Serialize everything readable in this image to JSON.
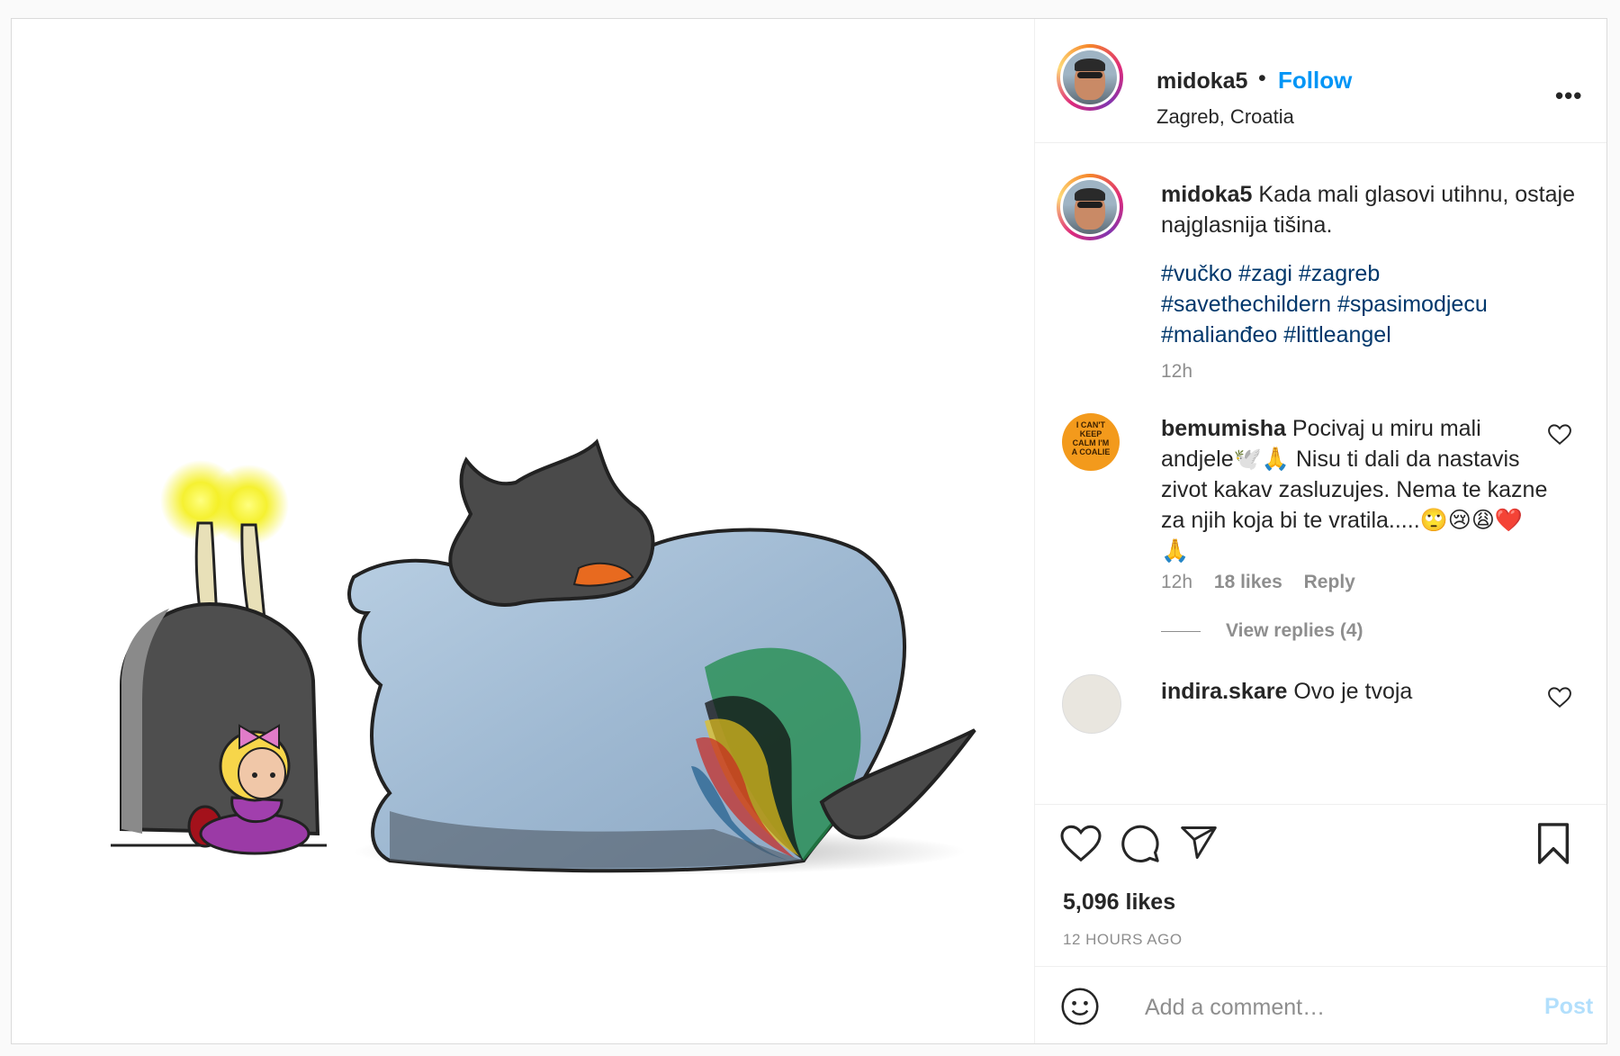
{
  "post": {
    "author": "midoka5",
    "separator": "•",
    "follow_label": "Follow",
    "location": "Zagreb, Croatia",
    "more_label": "•••",
    "caption": {
      "username": "midoka5",
      "text": "Kada mali glasovi utihnu, ostaje najglasnija tišina.",
      "hashtags": [
        "#vučko",
        "#zagi",
        "#zagreb",
        "#savethechildern",
        "#spasimodjecu",
        "#malianđeo",
        "#littleangel"
      ],
      "time": "12h"
    },
    "comments": [
      {
        "username": "bemumisha",
        "text": "Pocivaj u miru mali andjele🕊️🙏 Nisu ti dali da nastavis zivot kakav zasluzujes. Nema te kazne za njih koja bi te vratila.....🙄😢😩❤️🙏",
        "time": "12h",
        "likes": "18 likes",
        "reply_label": "Reply",
        "view_replies": "View replies (4)",
        "avatar_text": "I CAN'T KEEP CALM I'M A COALIE"
      },
      {
        "username": "indira.skare",
        "text": "Ovo je tvoja"
      }
    ],
    "like_count": "5,096 likes",
    "posted_ago": "12 HOURS AGO",
    "add_comment_placeholder": "Add a comment…",
    "post_label": "Post"
  },
  "colors": {
    "link_blue": "#0095f6",
    "hashtag": "#00376b",
    "muted": "#8e8e8e",
    "post_disabled": "#b2dffc"
  },
  "icons": [
    "heart-icon",
    "comment-icon",
    "share-icon",
    "bookmark-icon",
    "emoji-icon",
    "more-icon"
  ]
}
